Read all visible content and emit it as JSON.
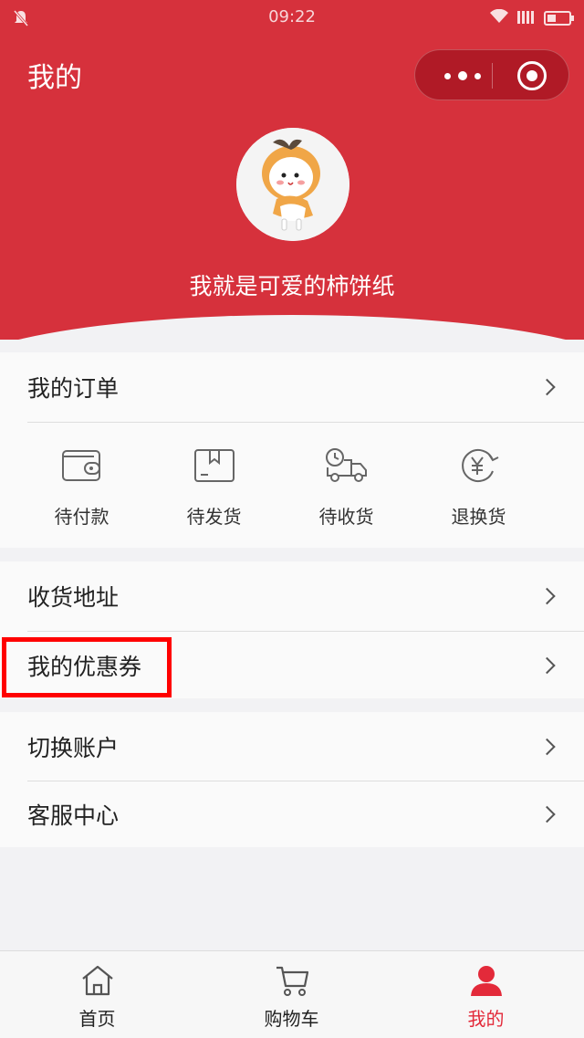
{
  "status_bar": {
    "time": "09:22"
  },
  "nav": {
    "title": "我的"
  },
  "profile": {
    "nickname": "我就是可爱的柿饼纸"
  },
  "orders": {
    "title": "我的订单",
    "statuses": [
      {
        "label": "待付款",
        "icon": "wallet-icon"
      },
      {
        "label": "待发货",
        "icon": "package-icon"
      },
      {
        "label": "待收货",
        "icon": "delivery-truck-icon"
      },
      {
        "label": "退换货",
        "icon": "yuan-refund-icon"
      }
    ]
  },
  "menu": {
    "address": "收货地址",
    "coupons": "我的优惠券",
    "switch_account": "切换账户",
    "customer_service": "客服中心"
  },
  "tabbar": {
    "items": [
      {
        "label": "首页",
        "icon": "home-icon",
        "active": false
      },
      {
        "label": "购物车",
        "icon": "cart-icon",
        "active": false
      },
      {
        "label": "我的",
        "icon": "user-icon",
        "active": true
      }
    ]
  },
  "colors": {
    "brand": "#d6313c",
    "active_tab": "#e32a3a",
    "highlight": "#ff0000"
  }
}
